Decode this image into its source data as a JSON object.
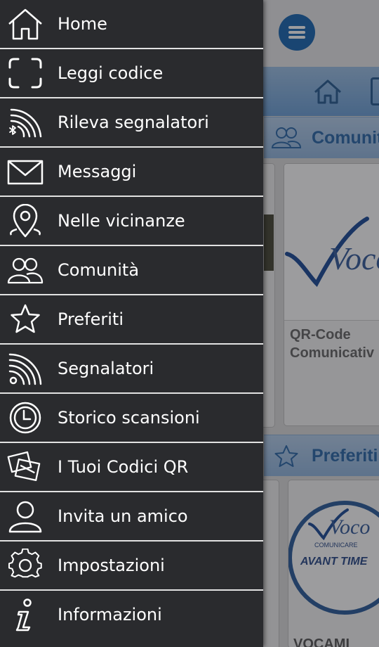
{
  "drawer": {
    "items": [
      {
        "label": "Home",
        "icon": "home-icon"
      },
      {
        "label": "Leggi codice",
        "icon": "scan-frame-icon"
      },
      {
        "label": "Rileva segnalatori",
        "icon": "bluetooth-beacon-icon"
      },
      {
        "label": "Messaggi",
        "icon": "envelope-icon"
      },
      {
        "label": "Nelle vicinanze",
        "icon": "location-pin-icon"
      },
      {
        "label": "Comunità",
        "icon": "users-icon"
      },
      {
        "label": "Preferiti",
        "icon": "star-icon"
      },
      {
        "label": "Segnalatori",
        "icon": "rss-icon"
      },
      {
        "label": "Storico scansioni",
        "icon": "clock-icon"
      },
      {
        "label": "I Tuoi Codici QR",
        "icon": "cards-icon"
      },
      {
        "label": "Invita un amico",
        "icon": "user-icon"
      },
      {
        "label": "Impostazioni",
        "icon": "gear-icon"
      },
      {
        "label": "Informazioni",
        "icon": "info-icon"
      }
    ]
  },
  "background": {
    "section_community": "Comunit",
    "section_favorites": "Preferiti",
    "card_title": "QR-Code\nComunicativ",
    "card_logo_text": "Voco",
    "card2_tagline": "COMUNICARE",
    "card2_slogan": "AVANT TIME",
    "bottom_text": "VOCAMI"
  },
  "colors": {
    "drawer_bg": "#2a2b2e",
    "divider": "#e2e2e2",
    "accent_blue": "#1e69b3",
    "section_text": "#2f6bab"
  }
}
